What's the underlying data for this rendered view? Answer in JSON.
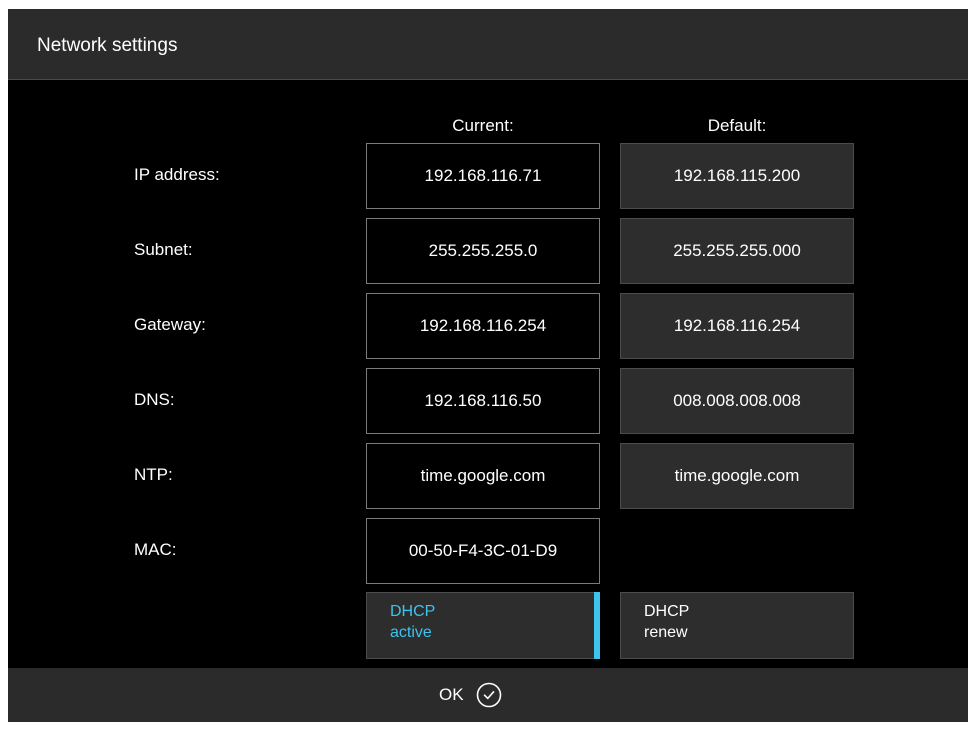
{
  "window": {
    "title": "Network settings"
  },
  "columns": {
    "current": "Current:",
    "default": "Default:"
  },
  "rows": [
    {
      "label": "IP address:",
      "current": "192.168.116.71",
      "default": "192.168.115.200"
    },
    {
      "label": "Subnet:",
      "current": "255.255.255.0",
      "default": "255.255.255.000"
    },
    {
      "label": "Gateway:",
      "current": "192.168.116.254",
      "default": "192.168.116.254"
    },
    {
      "label": "DNS:",
      "current": "192.168.116.50",
      "default": "008.008.008.008"
    },
    {
      "label": "NTP:",
      "current": "time.google.com",
      "default": "time.google.com"
    },
    {
      "label": "MAC:",
      "current": "00-50-F4-3C-01-D9"
    }
  ],
  "dhcp": {
    "active": {
      "line1": "DHCP",
      "line2": "active"
    },
    "renew": {
      "line1": "DHCP",
      "line2": "renew"
    }
  },
  "footer": {
    "ok_label": "OK",
    "ok_icon": "check-circle-icon"
  },
  "colors": {
    "accent": "#3cc3ee",
    "background": "#000000",
    "bar": "#2a2b2a"
  }
}
